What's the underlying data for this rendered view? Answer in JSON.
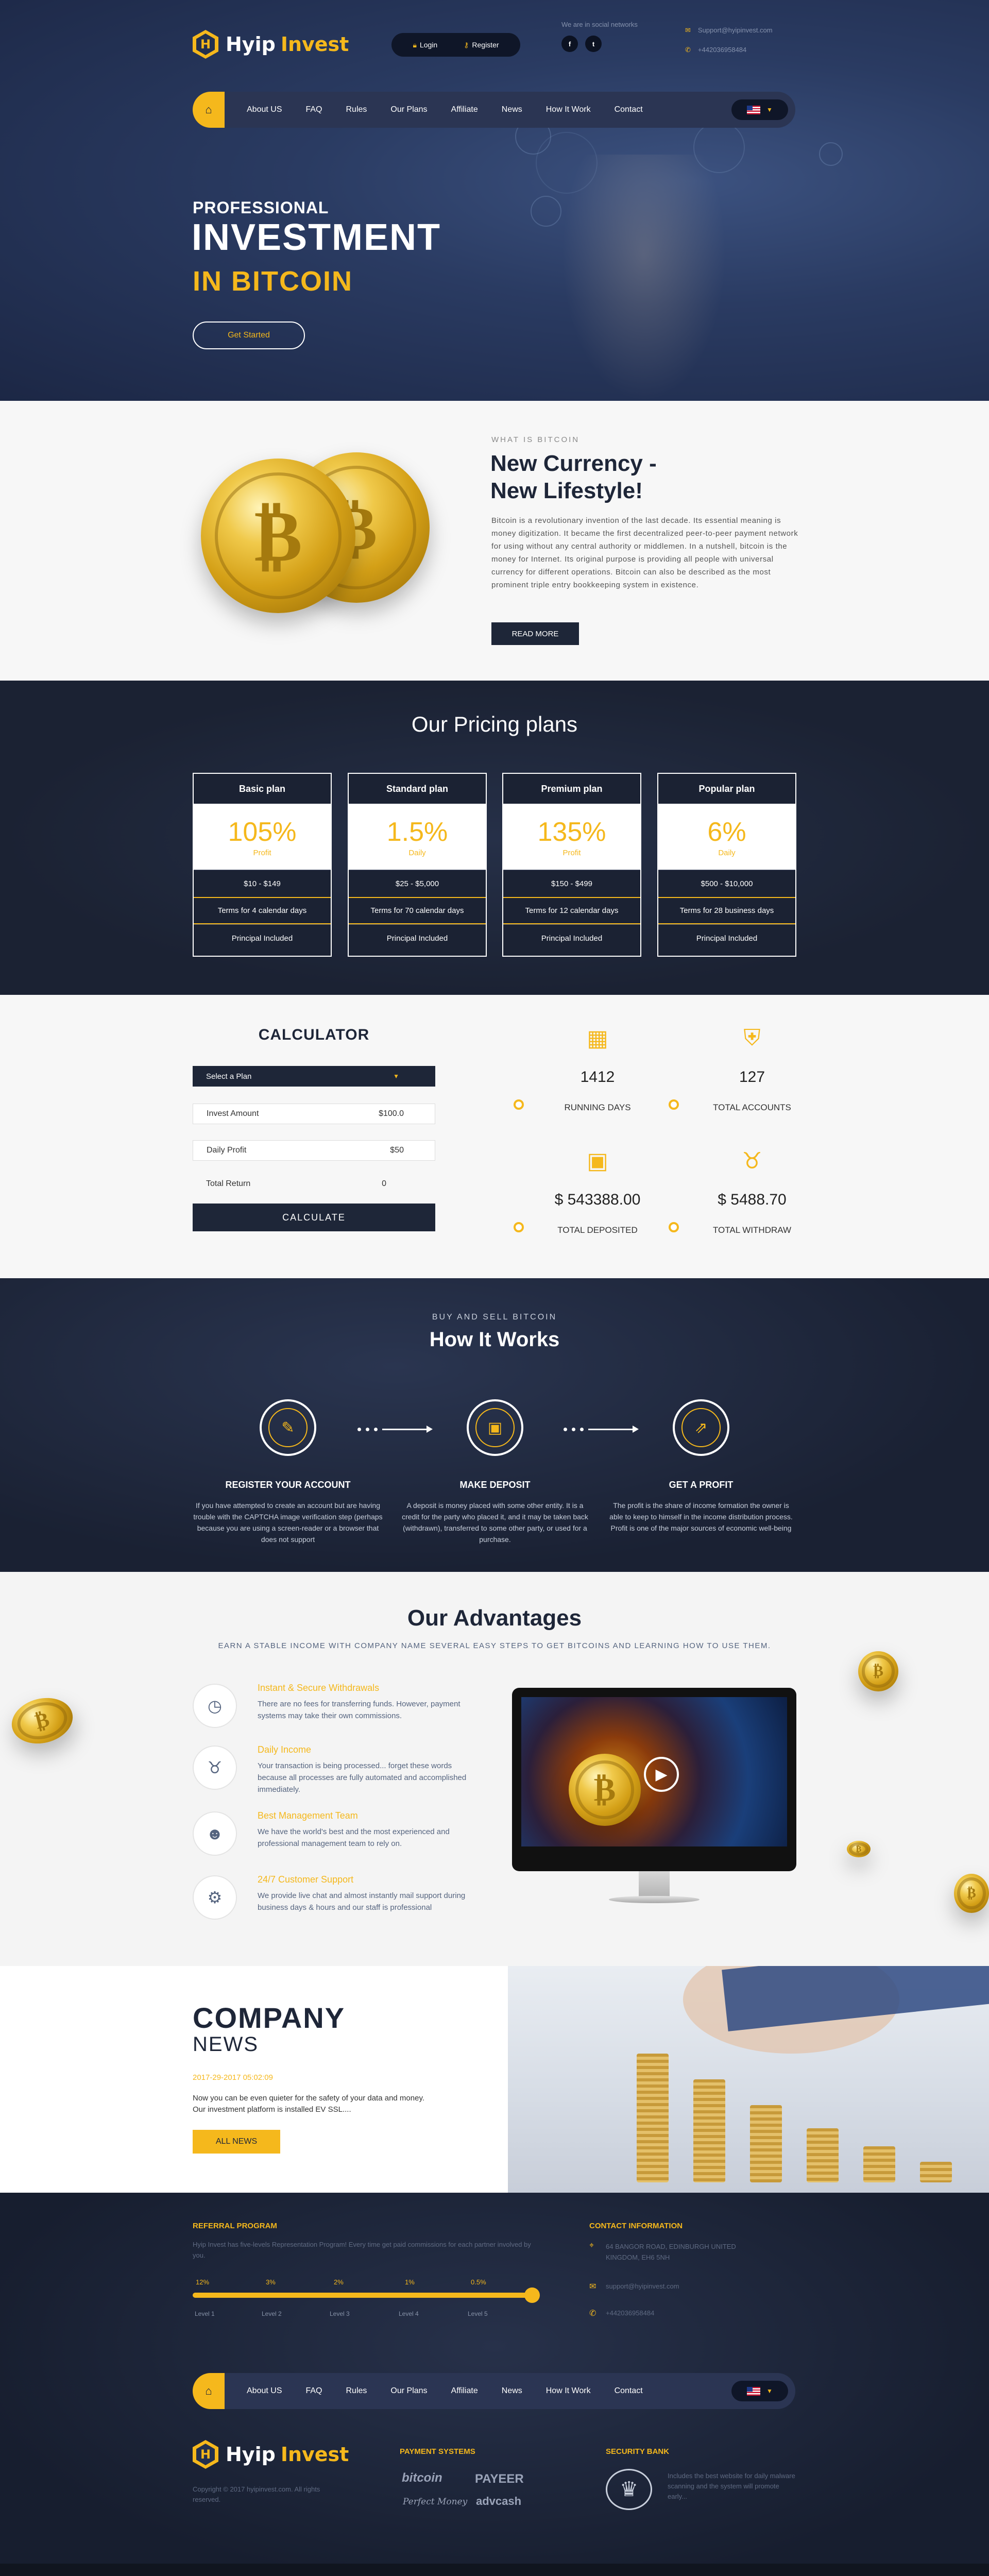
{
  "header": {
    "logo_word1": "Hyip",
    "logo_word2": "Invest",
    "login": "Login",
    "register": "Register",
    "social_label": "We are in social networks",
    "email": "Support@hyipinvest.com",
    "phone": "+442036958484"
  },
  "nav": {
    "items": [
      "About US",
      "FAQ",
      "Rules",
      "Our Plans",
      "Affiliate",
      "News",
      "How It Work",
      "Contact"
    ]
  },
  "hero": {
    "line1": "PROFESSIONAL",
    "line2": "INVESTMENT",
    "line3": "IN BITCOIN",
    "button": "Get Started"
  },
  "about": {
    "eyebrow": "WHAT IS BITCOIN",
    "title1": "New Currency -",
    "title2": "New Lifestyle!",
    "text": "Bitcoin is a revolutionary invention of the last decade. Its essential meaning is money digitization. It became the first decentralized peer-to-peer payment network for using without any central authority or middlemen. In a nutshell, bitcoin is the money for Internet. Its original purpose is providing all people with universal currency for different operations. Bitcoin can also be described as the most prominent triple entry bookkeeping system in existence.",
    "button": "READ MORE"
  },
  "pricing": {
    "title": "Our Pricing plans",
    "plans": [
      {
        "name": "Basic plan",
        "pct": "105%",
        "period": "Profit",
        "range": "$10 - $149",
        "terms": "Terms for 4 calendar days",
        "principal": "Principal Included"
      },
      {
        "name": "Standard plan",
        "pct": "1.5%",
        "period": "Daily",
        "range": "$25 - $5,000",
        "terms": "Terms for 70 calendar days",
        "principal": "Principal Included"
      },
      {
        "name": "Premium plan",
        "pct": "135%",
        "period": "Profit",
        "range": "$150 - $499",
        "terms": "Terms for 12 calendar days",
        "principal": "Principal Included"
      },
      {
        "name": "Popular plan",
        "pct": "6%",
        "period": "Daily",
        "range": "$500 - $10,000",
        "terms": "Terms for 28 business days",
        "principal": "Principal Included"
      }
    ]
  },
  "calculator": {
    "title": "CALCULATOR",
    "select": "Select a Plan",
    "invest_label": "Invest Amount",
    "invest_value": "$100.0",
    "daily_label": "Daily Profit",
    "daily_value": "$50",
    "total_label": "Total Return",
    "total_value": "0",
    "button": "CALCULATE"
  },
  "stats": [
    {
      "icon": "calendar-icon",
      "value": "1412",
      "label": "RUNNING DAYS"
    },
    {
      "icon": "shield-icon",
      "value": "127",
      "label": "TOTAL ACCOUNTS"
    },
    {
      "icon": "wallet-icon",
      "value": "$ 543388.00",
      "label": "TOTAL DEPOSITED"
    },
    {
      "icon": "piggy-bank-icon",
      "value": "$ 5488.70",
      "label": "TOTAL WITHDRAW"
    }
  ],
  "how": {
    "eyebrow": "BUY AND SELL BITCOIN",
    "title": "How It Works",
    "steps": [
      {
        "title": "REGISTER YOUR ACCOUNT",
        "text": "If you have attempted to create an account but are having trouble with the CAPTCHA image verification step (perhaps because you are using a screen-reader or a browser that does not support"
      },
      {
        "title": "MAKE DEPOSIT",
        "text": "A deposit is money placed with some other entity. It is a credit for the party who placed it, and it may be taken back (withdrawn), transferred to some other party, or used for a purchase."
      },
      {
        "title": "GET A PROFIT",
        "text": "The profit is the share of income formation the owner is able to keep to himself in the income distribution process. Profit is one of the major sources of economic well-being"
      }
    ]
  },
  "advantages": {
    "title": "Our Advantages",
    "subtitle": "EARN A STABLE INCOME WITH COMPANY NAME SEVERAL EASY STEPS TO GET BITCOINS AND LEARNING HOW TO USE THEM.",
    "items": [
      {
        "icon": "clock-icon",
        "title": "Instant & Secure Withdrawals",
        "text": "There are no fees for transferring funds. However, payment systems may take their own commissions."
      },
      {
        "icon": "piggy-bank-icon",
        "title": "Daily Income",
        "text": "Your transaction is being processed... forget these words because all processes are fully automated and accomplished immediately."
      },
      {
        "icon": "team-icon",
        "title": "Best Management Team",
        "text": "We have the world's best and the most experienced and professional management team to rely on."
      },
      {
        "icon": "support-icon",
        "title": "24/7 Customer Support",
        "text": "We provide live chat and almost instantly mail support during business days & hours and our staff is professional"
      }
    ]
  },
  "news": {
    "title1": "COMPANY",
    "title2": "NEWS",
    "date": "2017-29-2017 05:02:09",
    "text1": "Now you can be even quieter for the safety of your data and money.",
    "text2": "Our investment platform is installed EV SSL....",
    "button": "ALL NEWS"
  },
  "referral": {
    "title": "REFERRAL PROGRAM",
    "text": "Hyip Invest has five-levels Representation Program! Every time get paid commissions for each partner involved by you.",
    "levels": [
      {
        "pct": "12%",
        "label": "Level 1"
      },
      {
        "pct": "3%",
        "label": "Level 2"
      },
      {
        "pct": "2%",
        "label": "Level 3"
      },
      {
        "pct": "1%",
        "label": "Level 4"
      },
      {
        "pct": "0.5%",
        "label": "Level 5"
      }
    ]
  },
  "contact": {
    "title": "CONTACT INFORMATION",
    "address": "64 BANGOR ROAD, EDINBURGH UNITED KINGDOM, EH6 5NH",
    "email": "support@hyipinvest.com",
    "phone": "+442036958484"
  },
  "footer": {
    "copyright": "Copyright © 2017 hyipinvest.com. All rights reserved.",
    "payment_title": "PAYMENT SYSTEMS",
    "payments": [
      "bitcoin",
      "PAYEER",
      "Perfect Money",
      "advcash"
    ],
    "security_title": "SECURITY BANK",
    "security_text": "Includes the best website for daily malware scanning and the system will promote early..."
  },
  "colors": {
    "accent": "#f5b81c",
    "dark": "#1b2233",
    "navy": "#2a3b62"
  }
}
